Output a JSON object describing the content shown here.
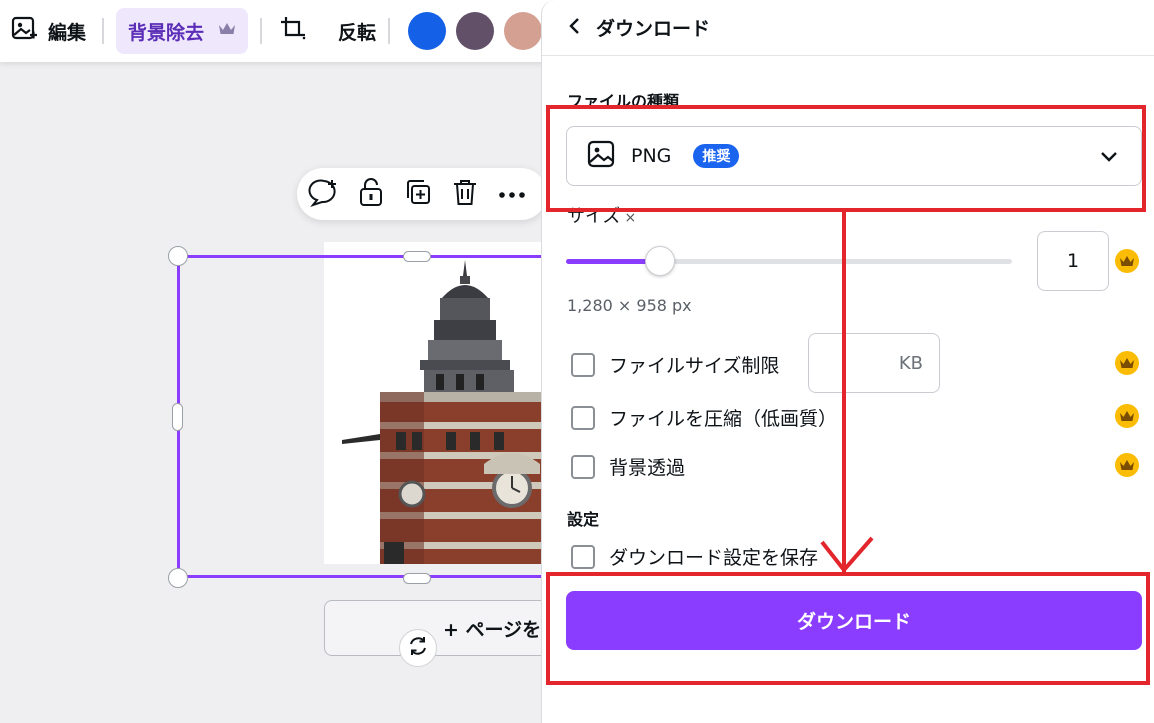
{
  "toolbar": {
    "edit_label": "編集",
    "bg_remove_label": "背景除去",
    "flip_label": "反転",
    "swatches": [
      "#1460e6",
      "#615068",
      "#d4a092"
    ]
  },
  "canvas": {
    "add_page_label": "+ ページを"
  },
  "panel": {
    "title": "ダウンロード",
    "file_type_label": "ファイルの種類",
    "file_type_value": "PNG",
    "recommended_badge": "推奨",
    "size_label": "サイズ",
    "size_suffix": "×",
    "scale_value": "1",
    "slider_fraction": 0.21,
    "dimensions": "1,280 × 958 px",
    "options": {
      "file_size_limit": "ファイルサイズ制限",
      "kb_unit": "KB",
      "compress": "ファイルを圧縮（低画質）",
      "transparent_bg": "背景透過"
    },
    "settings_label": "設定",
    "save_settings": "ダウンロード設定を保存",
    "download_button": "ダウンロード"
  },
  "colors": {
    "accent": "#8b3dff",
    "annotation": "#e3262c",
    "badge": "#1b64f0",
    "crown": "#fbbc05"
  }
}
